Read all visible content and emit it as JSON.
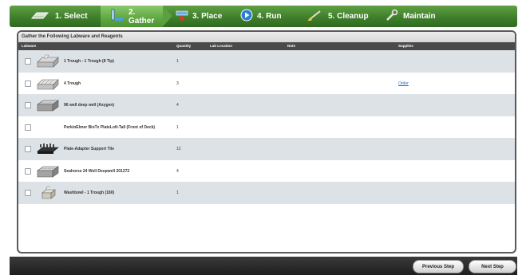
{
  "nav": {
    "steps": [
      {
        "label": "1. Select",
        "icon": "select-icon"
      },
      {
        "label": "2. Gather",
        "icon": "gather-icon"
      },
      {
        "label": "3. Place",
        "icon": "place-icon"
      },
      {
        "label": "4. Run",
        "icon": "run-icon"
      },
      {
        "label": "5. Cleanup",
        "icon": "cleanup-icon"
      },
      {
        "label": "Maintain",
        "icon": "maintain-icon"
      }
    ],
    "active_step": 1,
    "colors": {
      "bar": "#3f7f2b",
      "active": "#5fa742"
    }
  },
  "panel": {
    "title": "Gather the Following Labware and Reagents",
    "columns": {
      "labware": "Labware",
      "quantity": "Quantity",
      "lab_location": "Lab Location",
      "note": "Note",
      "supplies": "Supplies"
    },
    "rows": [
      {
        "name": "1 Trough - 1 Trough (8 Tip)",
        "quantity": "1",
        "supplies": "",
        "icon": "trough-icon"
      },
      {
        "name": "4 Trough",
        "quantity": "3",
        "supplies": "Order",
        "icon": "trough-icon"
      },
      {
        "name": "96 well deep well (Axygen)",
        "quantity": "4",
        "supplies": "",
        "icon": "deepwell-plate-icon"
      },
      {
        "name": "PerkinElmer BioTx PlateLoft-Tall (Front of Deck)",
        "quantity": "1",
        "supplies": "",
        "icon": ""
      },
      {
        "name": "Plate-Adapter Support Tile",
        "quantity": "12",
        "supplies": "",
        "icon": "adapter-tile-icon"
      },
      {
        "name": "Seahorse 24 Well Deepwell 201272",
        "quantity": "4",
        "supplies": "",
        "icon": "deepwell-plate-icon"
      },
      {
        "name": "Washbowl - 1 Trough (180)",
        "quantity": "1",
        "supplies": "",
        "icon": "washbowl-icon"
      }
    ]
  },
  "footer": {
    "previous": "Previous Step",
    "next": "Next Step"
  }
}
